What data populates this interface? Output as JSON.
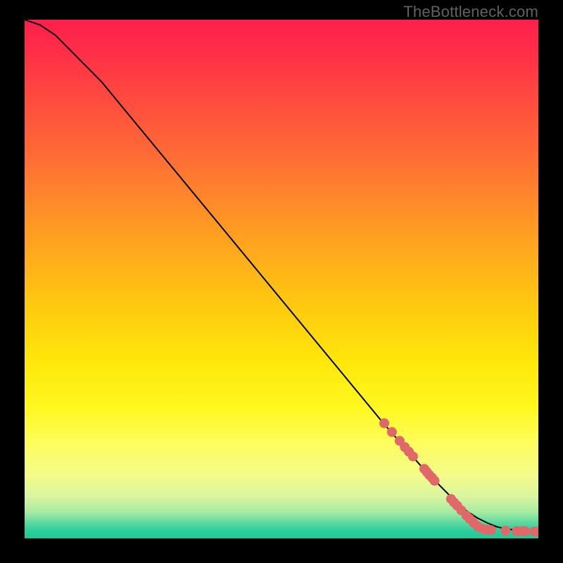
{
  "credit_text": "TheBottleneck.com",
  "chart_data": {
    "type": "line",
    "title": "",
    "xlabel": "",
    "ylabel": "",
    "xlim": [
      0,
      100
    ],
    "ylim": [
      0,
      100
    ],
    "curve": {
      "x": [
        0,
        3,
        6,
        10,
        15,
        20,
        30,
        40,
        50,
        60,
        70,
        78,
        82,
        85,
        88,
        90,
        92,
        94,
        96,
        98,
        100
      ],
      "y": [
        100,
        99,
        97,
        93,
        88,
        82,
        70,
        58,
        46,
        34,
        22,
        13,
        9,
        6,
        4,
        3,
        2.2,
        1.8,
        1.5,
        1.4,
        1.3
      ]
    },
    "series": [
      {
        "name": "highlighted-points",
        "type": "scatter",
        "x": [
          70,
          71.5,
          73,
          74,
          74.8,
          75.6,
          77.8,
          78.3,
          78.8,
          79.3,
          79.8,
          83,
          83.6,
          84.2,
          85,
          86,
          86.6,
          87.4,
          88.2,
          89,
          89.8,
          90.8,
          93.6,
          95.8,
          96.8,
          97.4,
          99.2,
          100
        ],
        "y": [
          22.2,
          20.5,
          18.8,
          17.6,
          16.7,
          15.8,
          13.4,
          12.8,
          12.2,
          11.7,
          11.1,
          7.6,
          6.9,
          6.3,
          5.4,
          4.4,
          3.8,
          3.0,
          2.3,
          1.9,
          1.7,
          1.6,
          1.5,
          1.4,
          1.4,
          1.4,
          1.3,
          1.3
        ]
      }
    ],
    "gradient_stops": [
      {
        "pos": 0.0,
        "color": "#ff1f4c"
      },
      {
        "pos": 0.4,
        "color": "#ff9a23"
      },
      {
        "pos": 0.66,
        "color": "#ffe70a"
      },
      {
        "pos": 0.92,
        "color": "#d9f5a0"
      },
      {
        "pos": 1.0,
        "color": "#1fc997"
      }
    ]
  }
}
